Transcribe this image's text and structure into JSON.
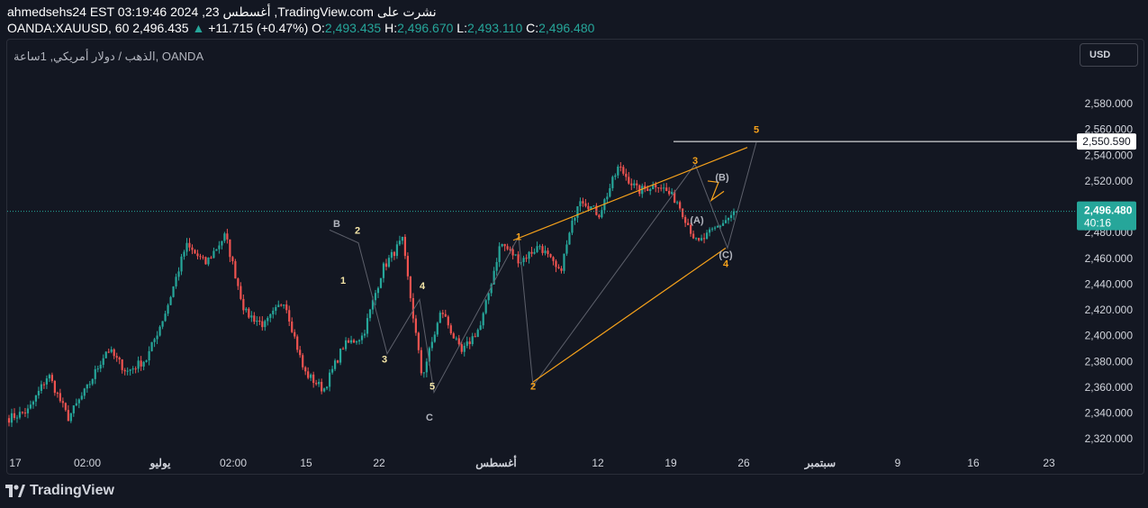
{
  "header": {
    "line1": "ahmedsehs24 EST 03:19:46 2024 ,23 أغسطس ,TradingView.com نشرت على",
    "symbol": "OANDA:XAUUSD, 60",
    "price": "2,496.435",
    "change_arrow": "▲",
    "change": "+11.715 (+0.47%)",
    "o_label": "O:",
    "o_value": "2,493.435",
    "h_label": "H:",
    "h_value": "2,496.670",
    "l_label": "L:",
    "l_value": "2,493.110",
    "c_label": "C:",
    "c_value": "2,496.480"
  },
  "chart": {
    "symbol_title": "الذهب / دولار أمريكي, 1ساعة, OANDA",
    "currency_button": "USD",
    "current_price_label": "2,496.480",
    "countdown": "40:16",
    "level_label": "2,550.590",
    "colors": {
      "up": "#26a69a",
      "down": "#ef5350",
      "wedge": "#f7a21b",
      "background": "#131722"
    }
  },
  "chart_data": {
    "type": "candlestick",
    "symbol": "OANDA:XAUUSD",
    "timeframe": "60",
    "y_ticks": [
      "2,580.000",
      "2,560.000",
      "2,540.000",
      "2,520.000",
      "2,500.000",
      "2,480.000",
      "2,460.000",
      "2,440.000",
      "2,420.000",
      "2,400.000",
      "2,380.000",
      "2,360.000",
      "2,340.000",
      "2,320.000"
    ],
    "y_tick_values": [
      2580,
      2560,
      2540,
      2520,
      2500,
      2480,
      2460,
      2440,
      2420,
      2400,
      2380,
      2360,
      2340,
      2320
    ],
    "ylim": [
      2311,
      2608
    ],
    "x_ticks": [
      "17",
      "02:00",
      "يوليو",
      "02:00",
      "15",
      "22",
      "أغسطس",
      "12",
      "19",
      "26",
      "سبتمبر",
      "9",
      "16",
      "23"
    ],
    "key_prices": [
      2336,
      2342,
      2370,
      2336,
      2360,
      2390,
      2372,
      2382,
      2420,
      2470,
      2456,
      2478,
      2418,
      2408,
      2428,
      2372,
      2358,
      2392,
      2400,
      2452,
      2474,
      2368,
      2420,
      2386,
      2408,
      2472,
      2458,
      2470,
      2448,
      2508,
      2494,
      2531,
      2512,
      2518,
      2504,
      2471,
      2484,
      2496.48
    ],
    "horizontal_level": 2550.59,
    "current_price": 2496.48,
    "wave_labels": [
      {
        "text": "B",
        "price": 2487,
        "color": "#b2b5be"
      },
      {
        "text": "2",
        "price": 2482,
        "color": "#f5e6a8"
      },
      {
        "text": "1",
        "price": 2443,
        "color": "#f5e6a8"
      },
      {
        "text": "4",
        "price": 2439,
        "color": "#f5e6a8"
      },
      {
        "text": "3",
        "price": 2382,
        "color": "#f5e6a8"
      },
      {
        "text": "5",
        "price": 2361,
        "color": "#f5e6a8"
      },
      {
        "text": "C",
        "price": 2337,
        "color": "#b2b5be"
      },
      {
        "text": "1",
        "price": 2477,
        "color": "#f7a21b"
      },
      {
        "text": "2",
        "price": 2361,
        "color": "#f7a21b"
      },
      {
        "text": "3",
        "price": 2536,
        "color": "#f7a21b"
      },
      {
        "text": "4",
        "price": 2456,
        "color": "#f7a21b"
      },
      {
        "text": "5",
        "price": 2560,
        "color": "#f7a21b"
      },
      {
        "text": "(B)",
        "price": 2523,
        "color": "#b2b5be"
      },
      {
        "text": "(A)",
        "price": 2490,
        "color": "#b2b5be"
      },
      {
        "text": "(C)",
        "price": 2463,
        "color": "#b2b5be"
      }
    ]
  },
  "footer": {
    "logo_text": "TradingView"
  }
}
